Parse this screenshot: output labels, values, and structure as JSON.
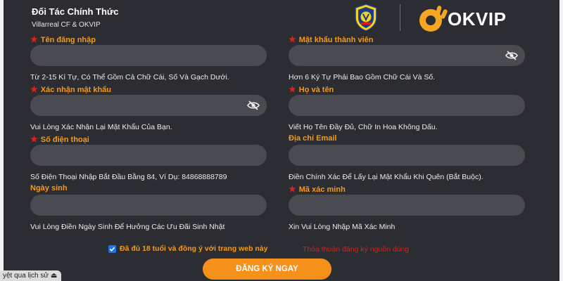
{
  "header": {
    "title": "Đối Tác Chính Thức",
    "subtitle": "Villarreal CF & OKVIP",
    "logo_brand": "OKVIP"
  },
  "fields": [
    {
      "id": "username",
      "label": "Tên đăng nhập",
      "required": true,
      "hint": "Từ 2-15 Kí Tự, Có Thể Gồm Cả Chữ Cái, Số Và Gạch Dưới.",
      "value": "",
      "password": false
    },
    {
      "id": "password",
      "label": "Mật khẩu thành viên",
      "required": true,
      "hint": "Hơn 6 Ký Tự Phải Bao Gồm Chữ Cái Và Số.",
      "value": "",
      "password": true
    },
    {
      "id": "confirm_password",
      "label": "Xác nhận mật khẩu",
      "required": true,
      "hint": "Vui Lòng Xác Nhận Lại Mật Khẩu Của Bạn.",
      "value": "",
      "password": true
    },
    {
      "id": "full_name",
      "label": "Họ và tên",
      "required": true,
      "hint": "Viết Họ Tên Đầy Đủ, Chữ In Hoa Không Dấu.",
      "value": "",
      "password": false
    },
    {
      "id": "phone",
      "label": "Số điện thoại",
      "required": true,
      "hint": "Số Điện Thoại Nhập Bắt Đầu Bằng 84, Ví Dụ: 84868888789",
      "value": "",
      "password": false
    },
    {
      "id": "email",
      "label": "Địa chỉ Email",
      "required": false,
      "hint": "Điền Chính Xác Để Lấy Lại Mật Khẩu Khi Quên (Bắt Buộc).",
      "value": "",
      "password": false
    },
    {
      "id": "birthday",
      "label": "Ngày sinh",
      "required": false,
      "hint": "Vui Lòng Điền Ngày Sinh Để Hưởng Các Ưu Đãi Sinh Nhật",
      "value": "",
      "password": false
    },
    {
      "id": "captcha",
      "label": "Mã xác minh",
      "required": true,
      "hint": "Xin Vui Lòng Nhập Mã Xác Minh",
      "value": "",
      "password": false
    }
  ],
  "agreement": {
    "checked": true,
    "text": "Đã đủ 18 tuổi và đồng ý với trang web này",
    "terms_link": "Thỏa thuận đăng ký nguồn dùng"
  },
  "submit_label": "ĐĂNG KÝ NGAY",
  "history_tab": "yệt qua lịch sử",
  "colors": {
    "background": "#2b2d33",
    "input": "#4a4b50",
    "label": "#f39a1e",
    "required": "#e0201c",
    "button": "#f5901a",
    "checkbox": "#1d73e8"
  }
}
